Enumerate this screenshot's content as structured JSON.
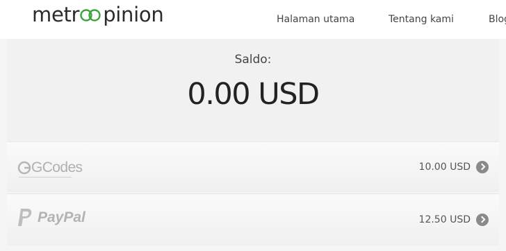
{
  "header": {
    "logo_text_left": "metr",
    "logo_text_right": "pinion",
    "nav": [
      "Halaman utama",
      "Tentang kami",
      "Blog"
    ]
  },
  "balance": {
    "label": "Saldo:",
    "value": "0.00 USD"
  },
  "rewards": [
    {
      "name": "GCodes",
      "amount": "10.00 USD",
      "icon": "chevron-right-circle-icon"
    },
    {
      "name": "PayPal",
      "amount": "12.50 USD",
      "icon": "chevron-right-circle-icon"
    }
  ],
  "colors": {
    "logo_accent": "#3aa53a",
    "text_dark": "#222222",
    "muted_logo": "#b3b3b3"
  }
}
